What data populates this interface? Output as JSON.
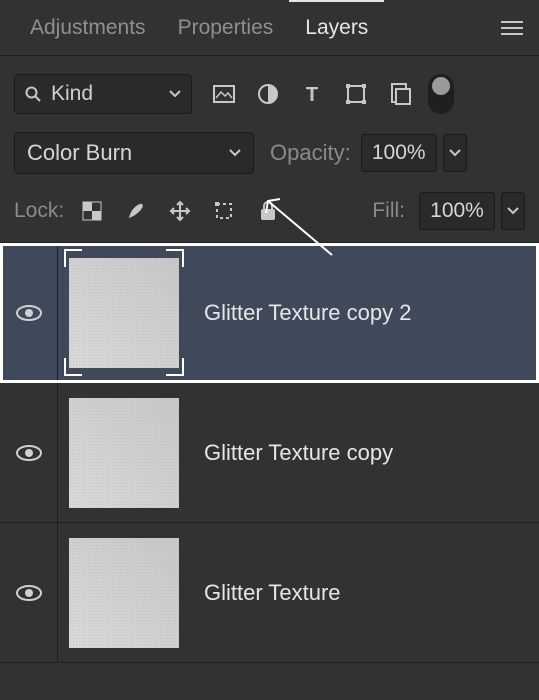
{
  "tabs": {
    "adjustments": "Adjustments",
    "properties": "Properties",
    "layers": "Layers"
  },
  "filter": {
    "kind": "Kind"
  },
  "blend": {
    "mode": "Color Burn",
    "opacityLabel": "Opacity:",
    "opacityValue": "100%"
  },
  "lock": {
    "label": "Lock:",
    "fillLabel": "Fill:",
    "fillValue": "100%"
  },
  "layers": [
    {
      "name": "Glitter Texture copy 2",
      "selected": true
    },
    {
      "name": "Glitter Texture copy",
      "selected": false
    },
    {
      "name": "Glitter Texture",
      "selected": false
    }
  ]
}
